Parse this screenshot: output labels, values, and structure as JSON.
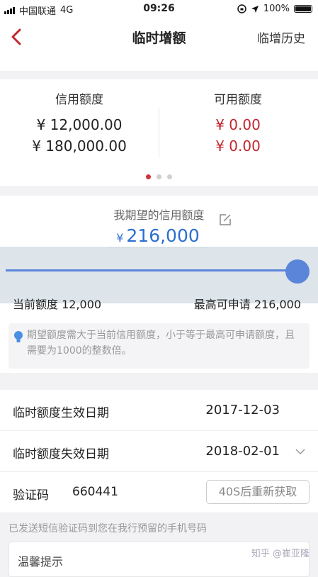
{
  "status_bar": {
    "carrier": "中国联通",
    "network": "4G",
    "time": "09:26",
    "battery": "100%"
  },
  "nav": {
    "title": "临时增额",
    "history_label": "临增历史"
  },
  "credit_card": {
    "credit_limit_label": "信用额度",
    "credit_limit_values": [
      "¥ 12,000.00",
      "¥ 180,000.00"
    ],
    "available_label": "可用额度",
    "available_values": [
      "¥ 0.00",
      "¥ 0.00"
    ],
    "dot_count": 3,
    "active_dot": 0
  },
  "expected": {
    "label": "我期望的信用额度",
    "currency": "¥",
    "amount": "216,000",
    "slider_fraction": 1.0,
    "current_label": "当前额度",
    "current_value": "12,000",
    "max_label": "最高可申请",
    "max_value": "216,000",
    "tip": "期望额度需大于当前信用额度，小于等于最高可申请额度，且需要为1000的整数倍。"
  },
  "rows": {
    "effective_label": "临时额度生效日期",
    "effective_value": "2017-12-03",
    "expiry_label": "临时额度失效日期",
    "expiry_value": "2018-02-01",
    "code_label": "验证码",
    "code_value": "660441",
    "resend_label": "40S后重新获取"
  },
  "sms_note": "已发送短信验证码到您在我行预留的手机号码",
  "warm_tip_label": "温馨提示",
  "watermark": "知乎 @崔亚隆",
  "colors": {
    "accent_red": "#c0282e",
    "slider_blue": "#5b85d8",
    "amount_blue": "#2b6fd0"
  }
}
